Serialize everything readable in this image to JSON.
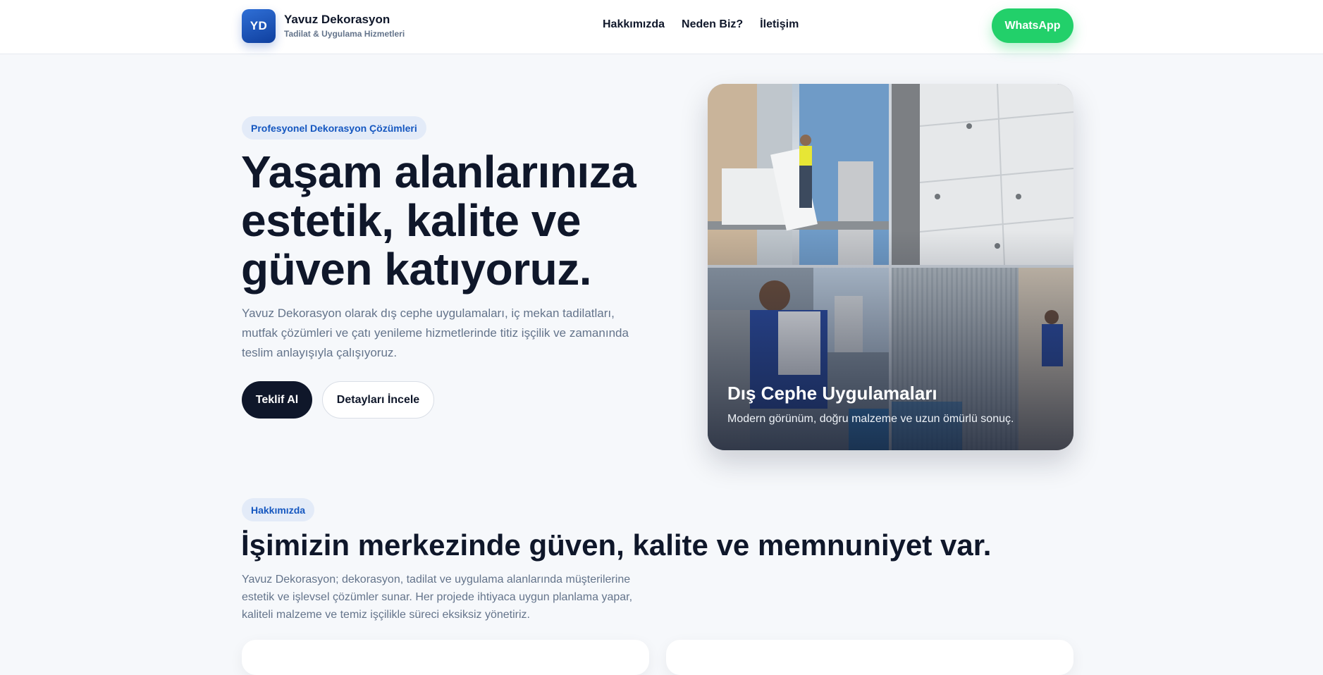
{
  "brand": {
    "initials": "YD",
    "name": "Yavuz Dekorasyon",
    "tagline": "Tadilat & Uygulama Hizmetleri"
  },
  "nav": {
    "items": [
      {
        "label": "Hakkımızda"
      },
      {
        "label": "Neden Biz?"
      },
      {
        "label": "İletişim"
      }
    ]
  },
  "header": {
    "whatsapp_label": "WhatsApp"
  },
  "hero": {
    "badge": "Profesyonel Dekorasyon Çözümleri",
    "title": "Yaşam alanlarınıza estetik, kalite ve güven katıyoruz.",
    "description": "Yavuz Dekorasyon olarak dış cephe uygulamaları, iç mekan tadilatları, mutfak çözümleri ve çatı yenileme hizmetlerinde titiz işçilik ve zamanında teslim anlayışıyla çalışıyoruz.",
    "primary_button": "Teklif Al",
    "secondary_button": "Detayları İncele",
    "card": {
      "title": "Dış Cephe Uygulamaları",
      "subtitle": "Modern görünüm, doğru malzeme ve uzun ömürlü sonuç."
    }
  },
  "about": {
    "badge": "Hakkımızda",
    "title": "İşimizin merkezinde güven, kalite ve memnuniyet var.",
    "description": "Yavuz Dekorasyon; dekorasyon, tadilat ve uygulama alanlarında müşterilerine estetik ve işlevsel çözümler sunar. Her projede ihtiyaca uygun planlama yapar, kaliteli malzeme ve temiz işçilikle süreci eksiksiz yönetiriz."
  },
  "colors": {
    "accent": "#1557c0",
    "dark": "#0f172a",
    "whatsapp": "#22d06a",
    "muted": "#64748b",
    "background": "#f6f8fb"
  }
}
